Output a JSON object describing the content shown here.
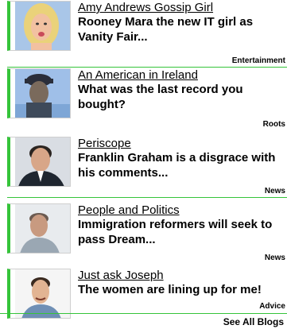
{
  "blogs": [
    {
      "name": "Amy Andrews Gossip Girl",
      "headline": "Rooney Mara the new IT girl as Vanity Fair...",
      "category": "Entertainment",
      "avatar": "blonde-woman-photo",
      "colors": {
        "bg": "#a9c6e8",
        "skin": "#f2c1a1",
        "hair": "#ead27a"
      }
    },
    {
      "name": "An American in Ireland",
      "headline": "What was the last record you bought?",
      "category": "Roots",
      "avatar": "man-with-cap-photo",
      "colors": {
        "bg": "#9fbfe8",
        "skin": "#7a6a5c",
        "hair": "#2a2e3a"
      }
    },
    {
      "name": "Periscope",
      "headline": "Franklin Graham is a disgrace with his comments...",
      "category": "News",
      "avatar": "man-in-suit-photo",
      "colors": {
        "bg": "#d9dde3",
        "skin": "#d8a688",
        "hair": "#2b2420"
      }
    },
    {
      "name": "People and Politics",
      "headline": "Immigration reformers will seek to pass Dream...",
      "category": "News",
      "avatar": "older-man-photo",
      "colors": {
        "bg": "#e8ebee",
        "skin": "#c89a80",
        "hair": "#6b5a50"
      }
    },
    {
      "name": "Just ask Joseph",
      "headline": "The women are lining up for me!",
      "category": "Advice",
      "avatar": "smiling-man-photo",
      "colors": {
        "bg": "#f5f5f5",
        "skin": "#e2b493",
        "hair": "#3a2a20"
      }
    }
  ],
  "see_all_label": "See All Blogs",
  "accent_color": "#35c43a"
}
